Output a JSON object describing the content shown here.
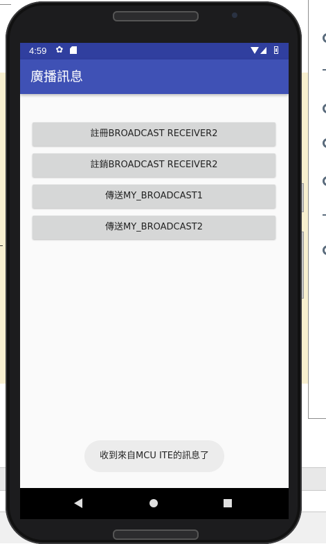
{
  "status_bar": {
    "time": "4:59",
    "icons": [
      "settings-icon",
      "sd-card-icon",
      "wifi-icon",
      "cell-signal-icon",
      "battery-icon"
    ]
  },
  "app_bar": {
    "title": "廣播訊息"
  },
  "buttons": [
    {
      "label": "註冊BROADCAST RECEIVER2"
    },
    {
      "label": "註銷BROADCAST RECEIVER2"
    },
    {
      "label": "傳送MY_BROADCAST1"
    },
    {
      "label": "傳送MY_BROADCAST2"
    }
  ],
  "toast": {
    "text": "收到來自MCU ITE的訊息了"
  },
  "nav_bar": {
    "icons": [
      "back-icon",
      "home-icon",
      "recents-icon"
    ]
  },
  "colors": {
    "status_bar": "#303f9f",
    "app_bar": "#3f51b5",
    "button_bg": "#d6d7d7",
    "screen_bg": "#fafafa",
    "ide_background": "#f7efcf"
  }
}
